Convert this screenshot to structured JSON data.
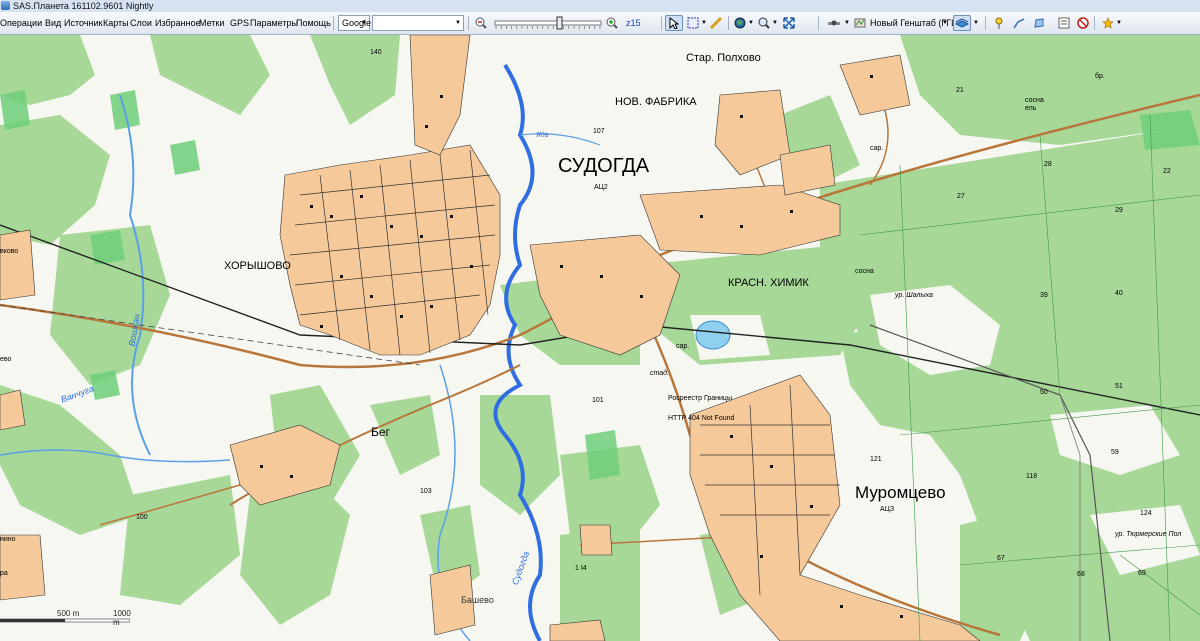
{
  "window": {
    "title": "SAS.Планета 161102.9601 Nightly"
  },
  "menu": [
    {
      "label": "Операции"
    },
    {
      "label": "Вид"
    },
    {
      "label": "Источник"
    },
    {
      "label": "Карты"
    },
    {
      "label": "Слои"
    },
    {
      "label": "Избранное"
    },
    {
      "label": "Метки"
    },
    {
      "label": "GPS"
    },
    {
      "label": "Параметры"
    },
    {
      "label": "Помощь"
    }
  ],
  "toolbar": {
    "map_source": "Google",
    "search_placeholder": "",
    "zoom_level": "z15",
    "zoom_fraction": 0.62,
    "layer_name": "Новый Генштаб (ГГЦ)"
  },
  "map": {
    "labels": {
      "sudogda": "СУДОГДА",
      "murom": "Муромцево",
      "khoryshovo": "ХОРЫШОВО",
      "nov_fabrika": "НОВ. ФАБРИКА",
      "star_polkhovo": "Стар. Полхово",
      "krasn_khimik": "КРАСН. ХИМИК",
      "beg": "Бег",
      "bashevo": "Башево",
      "rosreestr": "Росреестр Границы",
      "http404": "HTTP 404 Not Found",
      "atz1": "АЦ2",
      "atz2": "АЦЗ",
      "stad": "стад.",
      "sar1": "сар.",
      "sar2": "сар.",
      "sosna1": "сосна\nель",
      "sosna2": "сосна",
      "yada": "Яда",
      "sudogda_river": "Судогда",
      "vanchuga": "Ванчуга",
      "voshcha": "Вошкан",
      "ur_turm": "ур. Тюрмерские Пол",
      "num_101": "101",
      "num_103": "103",
      "num_100": "100",
      "num_121": "121",
      "num_118": "118",
      "num_124": "124",
      "num_140": "140",
      "num_21": "21",
      "num_28": "28",
      "num_27": "27",
      "num_29": "29",
      "num_39": "39",
      "num_40": "40",
      "num_50": "50",
      "num_51": "51",
      "num_59": "59",
      "num_67": "67",
      "num_68": "68",
      "num_69": "69",
      "num_22": "22",
      "num_107": "107",
      "num_14": "1 I4",
      "pazh": "ур. Шалыха",
      "left_vo": "вково",
      "left_nino": "нино",
      "left_dr": "ра",
      "left_chi": "ево",
      "br": "бр."
    },
    "scale": {
      "left": "500 m",
      "right": "1000 m"
    }
  }
}
